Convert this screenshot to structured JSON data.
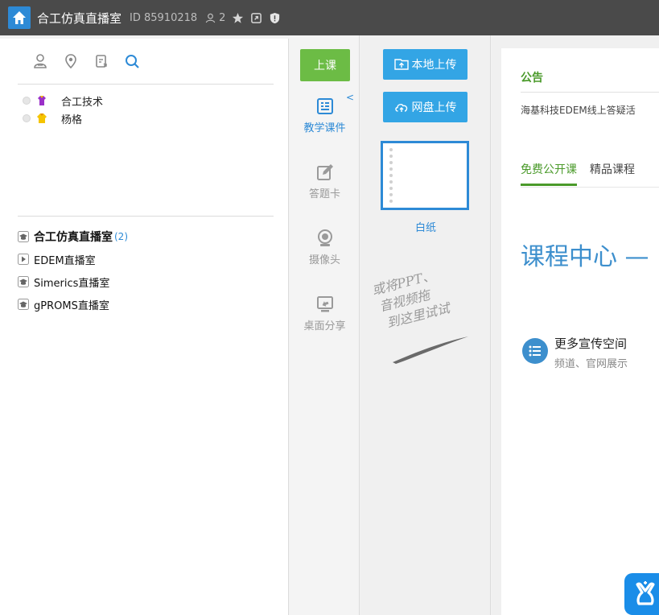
{
  "titlebar": {
    "room_title": "合工仿真直播室",
    "room_id": "ID 85910218",
    "user_count": "2",
    "accent": "#2d8ad6"
  },
  "left_panel": {
    "tools": [
      "user-icon",
      "location-icon",
      "export-icon",
      "search-icon"
    ],
    "users": [
      {
        "name": "合工技术",
        "icon": "vip-purple-icon"
      },
      {
        "name": "杨格",
        "icon": "vip-yellow-icon"
      }
    ],
    "rooms": [
      {
        "name": "合工仿真直播室",
        "count": "(2)",
        "icon": "cap-icon"
      },
      {
        "name": "EDEM直播室",
        "count": "",
        "icon": "play-icon"
      },
      {
        "name": "Simerics直播室",
        "count": "",
        "icon": "cap-icon"
      },
      {
        "name": "gPROMS直播室",
        "count": "",
        "icon": "cap-icon"
      }
    ]
  },
  "tool_column": {
    "start_class": "上课",
    "items": [
      {
        "label": "教学课件",
        "icon": "courseware-icon",
        "active": true
      },
      {
        "label": "答题卡",
        "icon": "answer-card-icon",
        "active": false
      },
      {
        "label": "摄像头",
        "icon": "camera-icon",
        "active": false
      },
      {
        "label": "桌面分享",
        "icon": "desktop-share-icon",
        "active": false
      }
    ]
  },
  "courseware": {
    "local_upload": "本地上传",
    "cloud_upload": "网盘上传",
    "blank_label": "白纸",
    "drag_hint": [
      "或将PPT、",
      "音视频拖",
      "到这里试试"
    ]
  },
  "content": {
    "notice_title": "公告",
    "notice_text": "海基科技EDEM线上答疑活",
    "tabs": [
      "免费公开课",
      "精品课程"
    ],
    "course_center": "课程中心 —",
    "promo_title": "更多宣传空间",
    "promo_sub": "频道、官网展示"
  },
  "colors": {
    "green": "#6cbc45",
    "blue": "#33a5e5",
    "accent_blue": "#3d8fcd",
    "notice_green": "#4a9a2a"
  }
}
